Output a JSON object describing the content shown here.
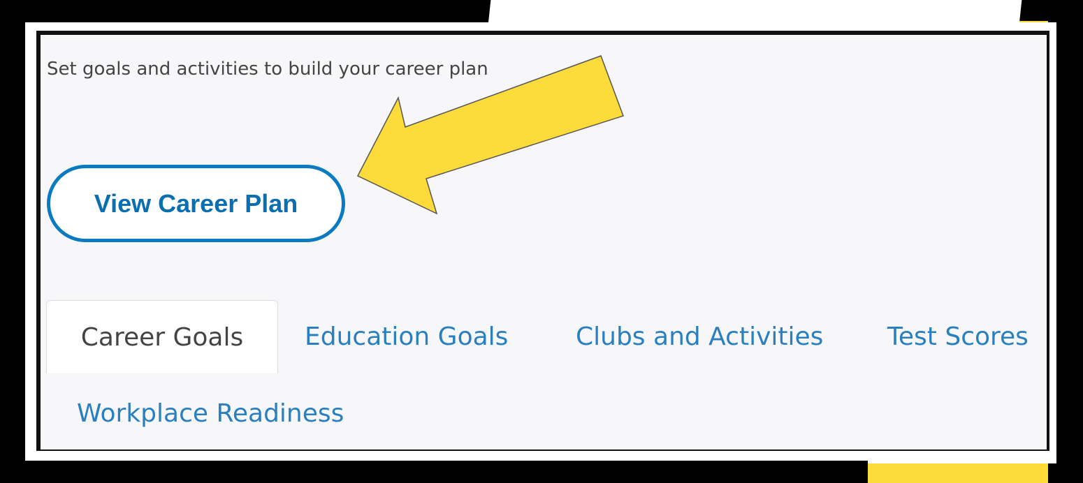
{
  "header": {
    "subtitle": "Set goals and activities to build your career plan"
  },
  "actions": {
    "view_career_plan": "View Career Plan"
  },
  "tabs": [
    {
      "label": "Career Goals",
      "active": true
    },
    {
      "label": "Education Goals",
      "active": false
    },
    {
      "label": "Clubs and Activities",
      "active": false
    },
    {
      "label": "Test Scores",
      "active": false
    },
    {
      "label": "Workplace Readiness",
      "active": false
    }
  ],
  "annotation": {
    "icon": "arrow-pointer-icon",
    "color": "#fddb3a"
  },
  "colors": {
    "accent": "#0a7bc0",
    "tab_link": "#2a7fbe",
    "highlight": "#fddb3a"
  }
}
